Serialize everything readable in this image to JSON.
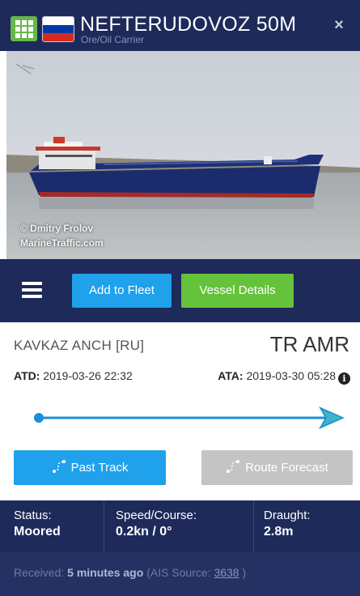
{
  "header": {
    "vessel_name": "NEFTERUDOVOZ 50M",
    "vessel_type": "Ore/Oil Carrier",
    "close_symbol": "×",
    "flag_colors": [
      "#ffffff",
      "#0039a6",
      "#d52b1e"
    ],
    "grid_icon": "grid-icon",
    "background": "#1d2a5a"
  },
  "photo": {
    "credit_line1": "© Dmitry Frolov",
    "credit_line2": "MarineTraffic.com"
  },
  "toolbar": {
    "menu_icon": "hamburger-icon",
    "add_to_fleet": "Add to Fleet",
    "vessel_details": "Vessel Details",
    "colors": {
      "blue": "#1fa1ec",
      "green": "#65c23b"
    }
  },
  "voyage": {
    "departure_port": "KAVKAZ ANCH [RU]",
    "destination_prefix": "TR",
    "destination_code": "AMR",
    "atd_label": "ATD:",
    "atd_value": "2019-03-26 22:32",
    "ata_label": "ATA:",
    "ata_value": "2019-03-30 05:28",
    "info_icon": "info-icon",
    "progress_fraction": 1.0,
    "past_track": "Past Track",
    "route_forecast": "Route Forecast"
  },
  "stats": {
    "status_label": "Status:",
    "status_value": "Moored",
    "speed_label": "Speed/Course:",
    "speed_value": "0.2kn / 0°",
    "draught_label": "Draught:",
    "draught_value": "2.8m"
  },
  "received": {
    "prefix": "Received:",
    "age": "5 minutes ago",
    "source_prefix": "(AIS Source:",
    "source_id": "3638",
    "source_suffix": ")"
  }
}
